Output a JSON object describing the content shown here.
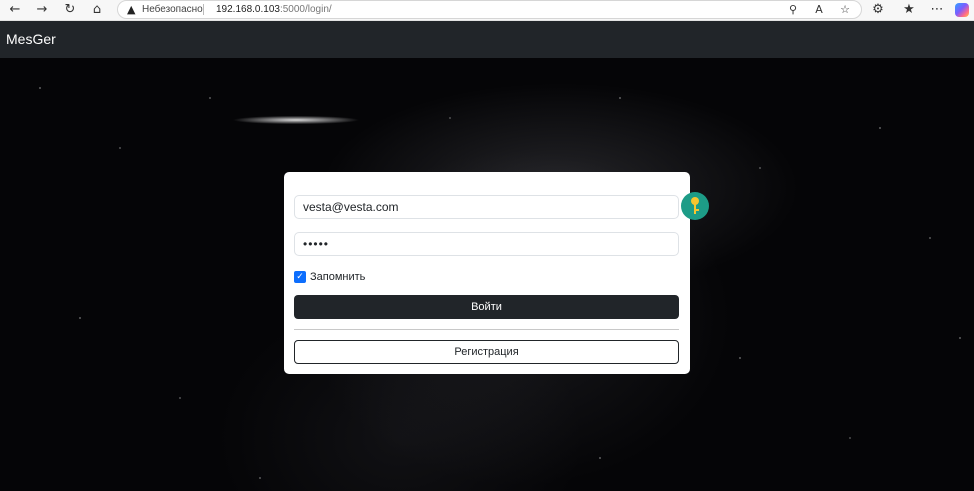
{
  "browser": {
    "back_icon": "back-arrow-icon",
    "forward_icon": "forward-arrow-icon",
    "refresh_icon": "refresh-icon",
    "home_icon": "home-icon",
    "security_warning": "Небезопасно",
    "url_host": "192.168.0.103",
    "url_path": ":5000/login/",
    "icons_right": [
      "key-icon",
      "read-aloud-icon",
      "favorite-star-icon",
      "extensions-icon",
      "favorites-icon",
      "more-menu-icon",
      "copilot-icon"
    ]
  },
  "app": {
    "brand": "MesGer",
    "navbar_color": "#212529"
  },
  "login": {
    "email_value": "vesta@vesta.com",
    "password_value": "•••••",
    "remember_checked": true,
    "remember_label": "Запомнить",
    "login_button": "Войти",
    "register_button": "Регистрация",
    "accent_color": "#0d6efd"
  }
}
